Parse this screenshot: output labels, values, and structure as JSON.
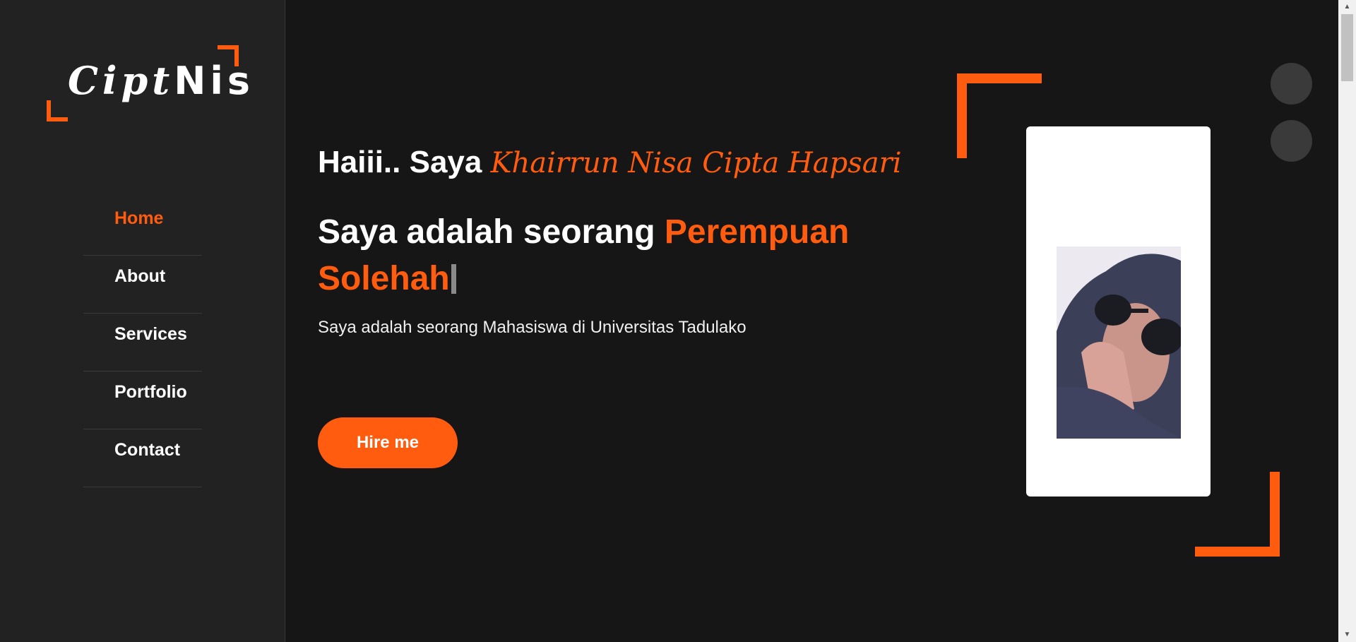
{
  "brand": {
    "logo_script": "Cipt",
    "logo_bold": "Nis",
    "accent_color": "#ff5c10"
  },
  "nav": {
    "items": [
      {
        "label": "Home",
        "active": true
      },
      {
        "label": "About",
        "active": false
      },
      {
        "label": "Services",
        "active": false
      },
      {
        "label": "Portfolio",
        "active": false
      },
      {
        "label": "Contact",
        "active": false
      }
    ]
  },
  "hero": {
    "greeting": "Haiii.. Saya",
    "name": "Khairrun Nisa Cipta Hapsari",
    "headline_prefix": "Saya adalah seorang",
    "headline_accent": "Perempuan Solehah",
    "description": "Saya adalah seorang Mahasiswa di Universitas Tadulako",
    "hire_button": "Hire me"
  },
  "photo": {
    "alt": "profile-photo"
  }
}
